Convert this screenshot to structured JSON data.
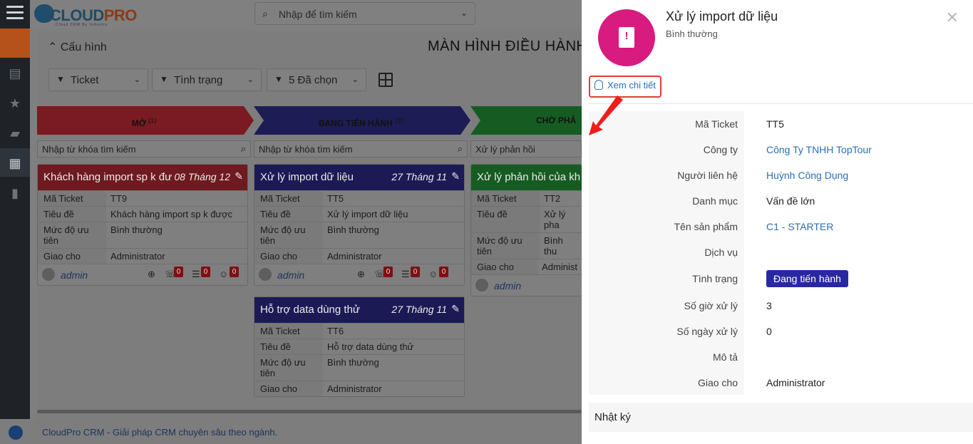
{
  "brand": {
    "name_a": "CLOUD",
    "name_b": "PRO",
    "tagline": "Cloud CRM By Industry"
  },
  "search": {
    "placeholder": "Nhập để tìm kiếm"
  },
  "board": {
    "config_label": "Cấu hình",
    "title": "MÀN HÌNH ĐIỀU HÀNH",
    "filters": [
      "Ticket",
      "Tình trạng",
      "5 Đã chọn"
    ]
  },
  "stages": [
    {
      "label": "MỞ",
      "count": "(1)",
      "color": "#7a1a22"
    },
    {
      "label": "ĐANG TIẾN HÀNH",
      "count": "(3)",
      "color": "#1e1c55"
    },
    {
      "label": "CHỜ PHẢ",
      "count": "",
      "color": "#165c22"
    }
  ],
  "column_search": {
    "placeholder": "Nhập từ khóa tìm kiếm",
    "placeholder_3": "Xử lý phản hồi"
  },
  "cards": [
    {
      "title": "Khách hàng import sp k đư...",
      "date": "08 Tháng 12",
      "header_color": "#6e1a20",
      "fields": [
        {
          "k": "Mã Ticket",
          "v": "TT9"
        },
        {
          "k": "Tiêu đề",
          "v": "Khách hàng import sp k được"
        },
        {
          "k": "Mức độ ưu tiên",
          "v": "Bình thường"
        },
        {
          "k": "Giao cho",
          "v": "Administrator"
        }
      ],
      "user": "admin",
      "badges": [
        "0",
        "0",
        "0"
      ]
    },
    {
      "title": "Xử lý import dữ liệu",
      "date": "27 Tháng 11",
      "header_color": "#1c1a55",
      "fields": [
        {
          "k": "Mã Ticket",
          "v": "TT5"
        },
        {
          "k": "Tiêu đề",
          "v": "Xử lý import dữ liệu"
        },
        {
          "k": "Mức độ ưu tiên",
          "v": "Bình thường"
        },
        {
          "k": "Giao cho",
          "v": "Administrator"
        }
      ],
      "user": "admin",
      "badges": [
        "0",
        "0",
        "0"
      ]
    },
    {
      "title": "Hỗ trợ data dùng thử",
      "date": "27 Tháng 11",
      "header_color": "#1c1a55",
      "fields": [
        {
          "k": "Mã Ticket",
          "v": "TT6"
        },
        {
          "k": "Tiêu đề",
          "v": "Hỗ trợ data dùng thử"
        },
        {
          "k": "Mức độ ưu tiên",
          "v": "Bình thường"
        },
        {
          "k": "Giao cho",
          "v": "Administrator"
        }
      ]
    },
    {
      "title": "Xử lý phản hồi của kh",
      "date": "",
      "header_color": "#165c22",
      "fields": [
        {
          "k": "Mã Ticket",
          "v": "TT2"
        },
        {
          "k": "Tiêu đề",
          "v": "Xử lý pha"
        },
        {
          "k": "Mức độ ưu tiên",
          "v": "Bình thu"
        },
        {
          "k": "Giao cho",
          "v": "Administ"
        }
      ],
      "user": "admin"
    }
  ],
  "footer": {
    "text": "CloudPro CRM - Giải pháp CRM chuyên sâu theo ngành."
  },
  "panel": {
    "title": "Xử lý import dữ liệu",
    "subtitle": "Bình thường",
    "detail_button": "Xem chi tiết",
    "accent": "#d81b7e",
    "fields": [
      {
        "k": "Mã Ticket",
        "v": "TT5",
        "link": false
      },
      {
        "k": "Công ty",
        "v": "Công Ty TNHH TopTour",
        "link": true
      },
      {
        "k": "Người liên hệ",
        "v": "Huỳnh Công Dụng",
        "link": true
      },
      {
        "k": "Danh mục",
        "v": "Vấn đề lớn",
        "link": false
      },
      {
        "k": "Tên sản phẩm",
        "v": "C1 - STARTER",
        "link": true
      },
      {
        "k": "Dịch vụ",
        "v": "",
        "link": false
      },
      {
        "k": "Tình trạng",
        "v": "Đang tiến hành",
        "badge": true
      },
      {
        "k": "Số giờ xử lý",
        "v": "3",
        "link": false
      },
      {
        "k": "Số ngày xử lý",
        "v": "0",
        "link": false
      },
      {
        "k": "Mô tả",
        "v": "",
        "link": false
      },
      {
        "k": "Giao cho",
        "v": "Administrator",
        "link": false
      }
    ],
    "log_label": "Nhật ký"
  }
}
